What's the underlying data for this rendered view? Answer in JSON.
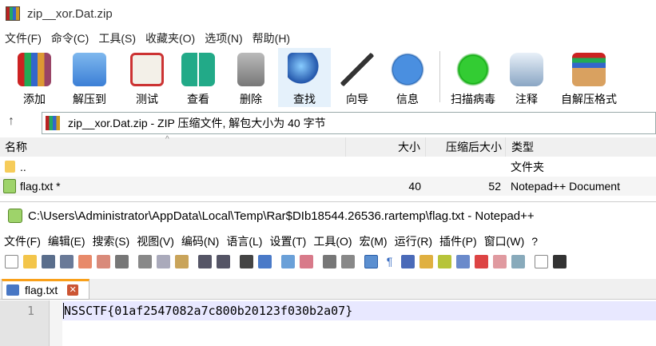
{
  "rar": {
    "title": "zip__xor.Dat.zip",
    "menu": [
      "文件(F)",
      "命令(C)",
      "工具(S)",
      "收藏夹(O)",
      "选项(N)",
      "帮助(H)"
    ],
    "toolbar": [
      {
        "label": "添加",
        "icon": "add-books-icon"
      },
      {
        "label": "解压到",
        "icon": "extract-folder-icon"
      },
      {
        "label": "测试",
        "icon": "test-clipboard-icon"
      },
      {
        "label": "查看",
        "icon": "view-book-icon"
      },
      {
        "label": "删除",
        "icon": "trash-icon"
      },
      {
        "label": "查找",
        "icon": "magnifier-icon"
      },
      {
        "label": "向导",
        "icon": "wizard-wand-icon"
      },
      {
        "label": "信息",
        "icon": "info-icon"
      },
      {
        "label": "扫描病毒",
        "icon": "virus-scan-icon"
      },
      {
        "label": "注释",
        "icon": "comment-icon"
      },
      {
        "label": "自解压格式",
        "icon": "sfx-box-icon"
      }
    ],
    "address": "zip__xor.Dat.zip - ZIP 压缩文件, 解包大小为 40 字节",
    "columns": {
      "name": "名称",
      "size": "大小",
      "packed": "压缩后大小",
      "type": "类型"
    },
    "rows": [
      {
        "name": "..",
        "size": "",
        "packed": "",
        "type": "文件夹"
      },
      {
        "name": "flag.txt *",
        "size": "40",
        "packed": "52",
        "type": "Notepad++ Document"
      }
    ]
  },
  "npp": {
    "title": "C:\\Users\\Administrator\\AppData\\Local\\Temp\\Rar$DIb18544.26536.rartemp\\flag.txt - Notepad++",
    "menu": [
      "文件(F)",
      "编辑(E)",
      "搜索(S)",
      "视图(V)",
      "编码(N)",
      "语言(L)",
      "设置(T)",
      "工具(O)",
      "宏(M)",
      "运行(R)",
      "插件(P)",
      "窗口(W)",
      "?"
    ],
    "tab": "flag.txt",
    "line_number": "1",
    "content": "NSSCTF{01af2547082a7c800b20123f030b2a07}"
  },
  "colors": {
    "accent": "#f9a01a",
    "selection": "#e8e8ff",
    "header": "#f0f0f0",
    "highlight": "#e5f1fb"
  }
}
